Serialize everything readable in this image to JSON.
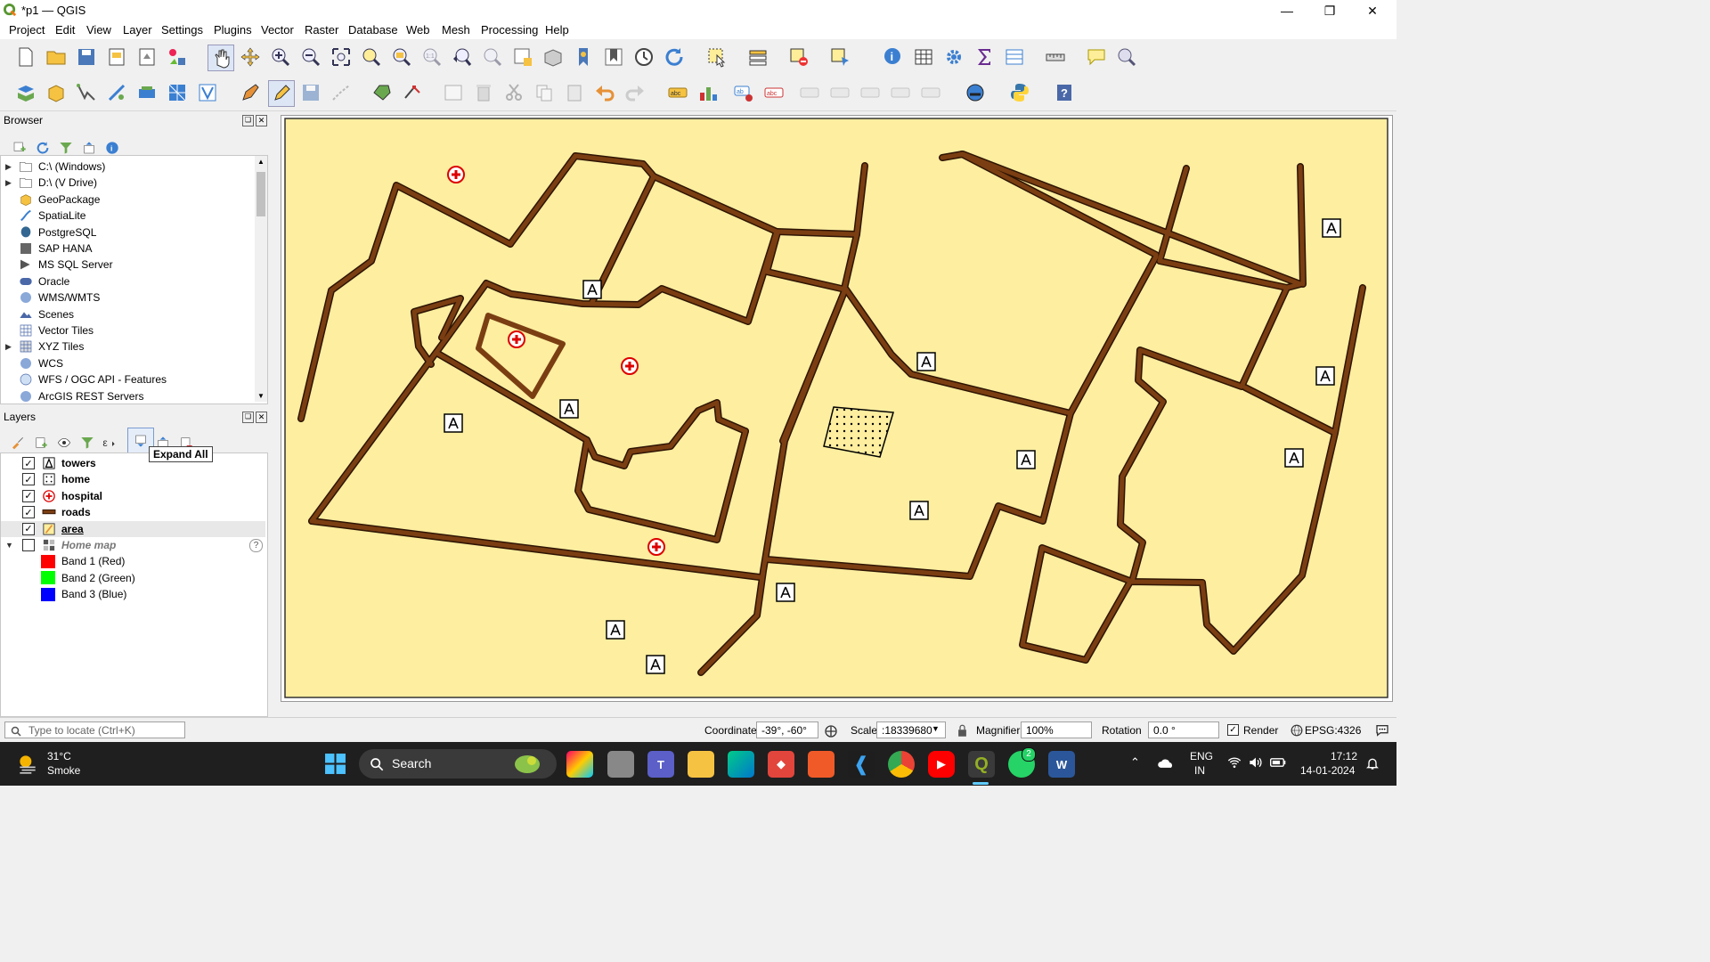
{
  "window": {
    "title": "*p1 — QGIS"
  },
  "menu": [
    "Project",
    "Edit",
    "View",
    "Layer",
    "Settings",
    "Plugins",
    "Vector",
    "Raster",
    "Database",
    "Web",
    "Mesh",
    "Processing",
    "Help"
  ],
  "browser": {
    "title": "Browser",
    "items": [
      {
        "label": "C:\\ (Windows)",
        "icon": "folder-icon",
        "expandable": true
      },
      {
        "label": "D:\\ (V Drive)",
        "icon": "folder-icon",
        "expandable": true
      },
      {
        "label": "GeoPackage",
        "icon": "geopackage-icon",
        "expandable": false
      },
      {
        "label": "SpatiaLite",
        "icon": "spatialite-icon",
        "expandable": false
      },
      {
        "label": "PostgreSQL",
        "icon": "postgresql-icon",
        "expandable": false
      },
      {
        "label": "SAP HANA",
        "icon": "sap-hana-icon",
        "expandable": false
      },
      {
        "label": "MS SQL Server",
        "icon": "mssql-icon",
        "expandable": false
      },
      {
        "label": "Oracle",
        "icon": "oracle-icon",
        "expandable": false
      },
      {
        "label": "WMS/WMTS",
        "icon": "wms-icon",
        "expandable": false
      },
      {
        "label": "Scenes",
        "icon": "scenes-icon",
        "expandable": false
      },
      {
        "label": "Vector Tiles",
        "icon": "vector-tiles-icon",
        "expandable": false
      },
      {
        "label": "XYZ Tiles",
        "icon": "xyz-tiles-icon",
        "expandable": true
      },
      {
        "label": "WCS",
        "icon": "wcs-icon",
        "expandable": false
      },
      {
        "label": "WFS / OGC API - Features",
        "icon": "wfs-icon",
        "expandable": false
      },
      {
        "label": "ArcGIS REST Servers",
        "icon": "arcgis-icon",
        "expandable": false
      }
    ]
  },
  "layers": {
    "title": "Layers",
    "tooltip": "Expand All",
    "items": [
      {
        "label": "towers",
        "checked": true,
        "bold": true
      },
      {
        "label": "home",
        "checked": true,
        "bold": true
      },
      {
        "label": "hospital",
        "checked": true,
        "bold": true
      },
      {
        "label": "roads",
        "checked": true,
        "bold": true
      },
      {
        "label": "area",
        "checked": true,
        "bold": true,
        "underline": true
      },
      {
        "label": "Home map",
        "checked": false,
        "italic": true
      },
      {
        "label": "Band 1 (Red)",
        "color": "#ff0000"
      },
      {
        "label": "Band 2 (Green)",
        "color": "#00ff00"
      },
      {
        "label": "Band 3 (Blue)",
        "color": "#0000ff"
      }
    ]
  },
  "map": {
    "background": "#fdeea0",
    "road_color": "#7a3e12"
  },
  "status": {
    "locate_placeholder": "Type to locate (Ctrl+K)",
    "coordinate_label": "Coordinate",
    "coordinate_value": "-39°, -60°",
    "scale_label": "Scale",
    "scale_value": ":18339680",
    "magnifier_label": "Magnifier",
    "magnifier_value": "100%",
    "rotation_label": "Rotation",
    "rotation_value": "0.0 °",
    "render_label": "Render",
    "crs": "EPSG:4326"
  },
  "taskbar": {
    "weather_temp": "31°C",
    "weather_desc": "Smoke",
    "search": "Search",
    "lang1": "ENG",
    "lang2": "IN",
    "time": "17:12",
    "date": "14-01-2024",
    "whatsapp_badge": "2"
  }
}
